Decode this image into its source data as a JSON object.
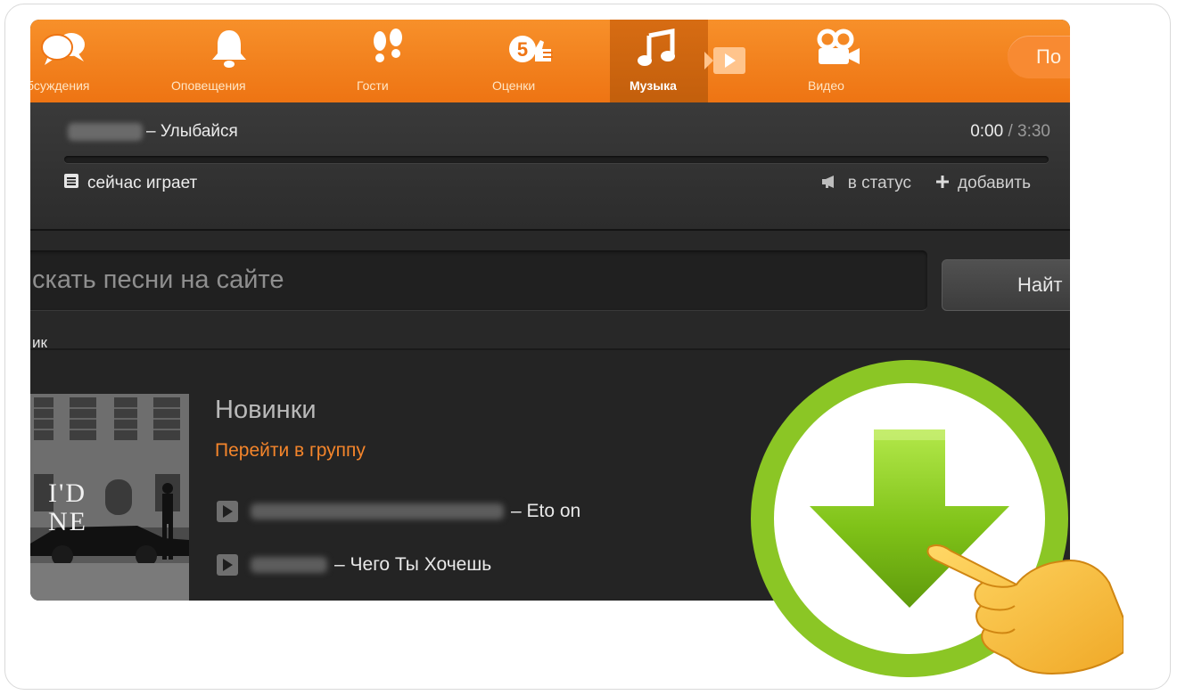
{
  "nav": {
    "items": [
      {
        "label": "бсуждения",
        "icon": "discussions-icon"
      },
      {
        "label": "Оповещения",
        "icon": "bell-icon"
      },
      {
        "label": "Гости",
        "icon": "footprints-icon"
      },
      {
        "label": "Оценки",
        "icon": "ratings-icon"
      },
      {
        "label": "Музыка",
        "icon": "music-note-icon",
        "active": true
      },
      {
        "label": "Видео",
        "icon": "video-camera-icon"
      }
    ],
    "search_label": "По"
  },
  "player": {
    "track_title": "– Улыбайся",
    "time_current": "0:00",
    "time_separator": " / ",
    "time_total": "3:30",
    "progress": 0,
    "now_playing_label": "сейчас играет",
    "to_status_label": "в статус",
    "add_label": "добавить"
  },
  "search": {
    "placeholder": "скать песни на сайте",
    "button_label": "Найт",
    "tab_label": "ик"
  },
  "section": {
    "title": "Новинки",
    "group_link": "Перейти в группу",
    "songs": [
      {
        "title": "– Eto on"
      },
      {
        "title": "– Чего Ты Хочешь"
      }
    ]
  },
  "cover": {
    "text": "I'D NE"
  },
  "colors": {
    "nav_orange": "#f28424",
    "link_orange": "#f4852b",
    "download_green": "#7fc218"
  }
}
